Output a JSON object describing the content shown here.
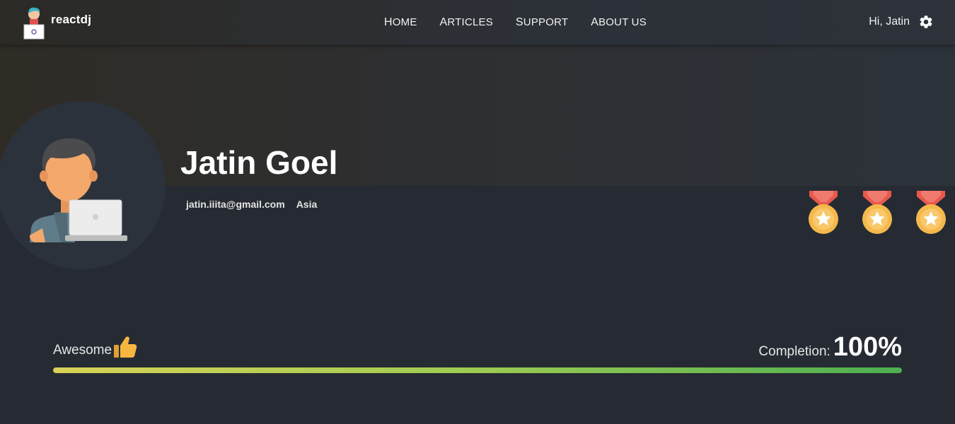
{
  "navbar": {
    "brand": "reactdj",
    "links": [
      "Home",
      "Articles",
      "Support",
      "About Us"
    ],
    "greeting": "Hi, Jatin"
  },
  "profile": {
    "name": "Jatin Goel",
    "email": "jatin.iiita@gmail.com",
    "region": "Asia",
    "medal_count": 3
  },
  "progress": {
    "label": "Awesome",
    "completion_label": "Completion:",
    "completion_value": "100%",
    "fraction": 1.0
  },
  "colors": {
    "background": "#262b33",
    "medal_gold": "#f5b84c",
    "medal_ribbon": "#e8594d",
    "progress_start": "#d8d257",
    "progress_end": "#4caf50"
  },
  "icons": {
    "settings": "gear-icon",
    "thumb": "thumbs-up-icon",
    "medal": "medal-icon"
  }
}
